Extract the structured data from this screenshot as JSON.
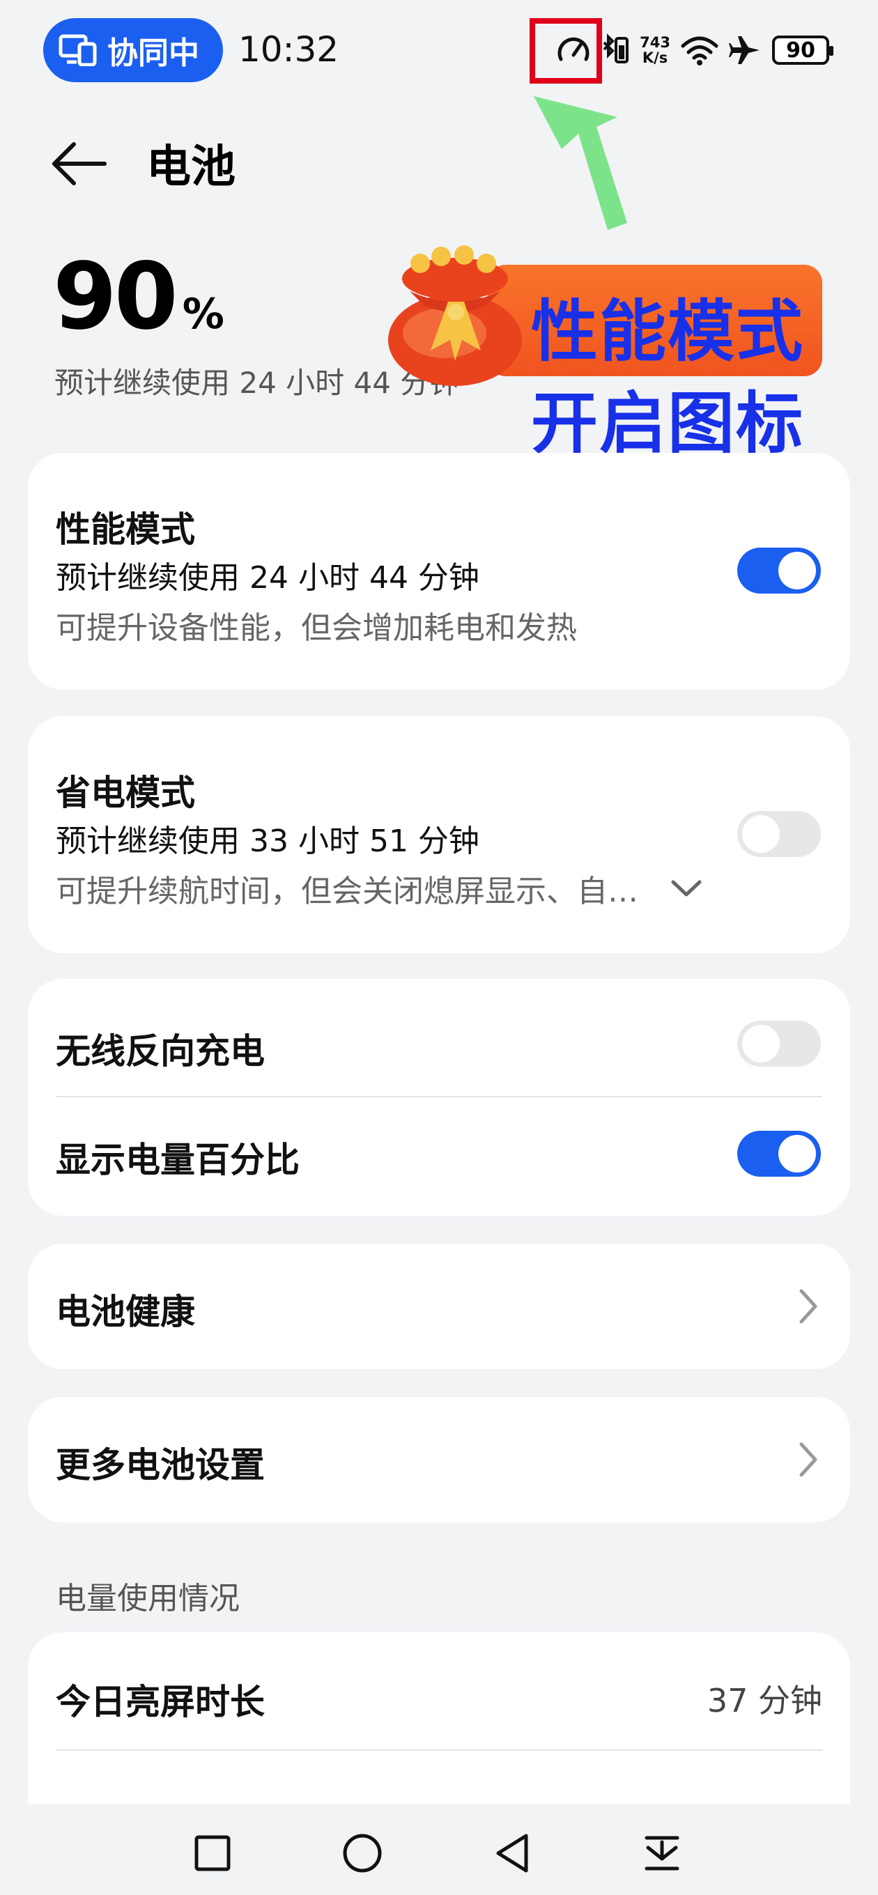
{
  "status": {
    "collab_label": "协同中",
    "time": "10:32",
    "net_speed_value": "743",
    "net_speed_unit": "K/s",
    "battery": "90"
  },
  "header": {
    "title": "电池"
  },
  "summary": {
    "percent": "90",
    "percent_sign": "%",
    "estimate": "预计继续使用 24 小时 44 分钟"
  },
  "annotation": {
    "line1": "性能模式",
    "line2": "开启图标",
    "accent_color": "#E0001A",
    "arrow_color": "#7DE38A"
  },
  "performance": {
    "title": "性能模式",
    "estimate": "预计继续使用 24 小时 44 分钟",
    "desc": "可提升设备性能，但会增加耗电和发热",
    "enabled": true
  },
  "power_saving": {
    "title": "省电模式",
    "estimate": "预计继续使用 33 小时 51 分钟",
    "desc": "可提升续航时间，但会关闭熄屏显示、自…",
    "enabled": false
  },
  "toggles": {
    "wireless_reverse": {
      "label": "无线反向充电",
      "enabled": false
    },
    "show_percent": {
      "label": "显示电量百分比",
      "enabled": true
    }
  },
  "links": {
    "battery_health": "电池健康",
    "more_settings": "更多电池设置"
  },
  "usage": {
    "section_title": "电量使用情况",
    "screen_time_label": "今日亮屏时长",
    "screen_time_value": "37 分钟"
  },
  "colors": {
    "accent": "#1B5FF0",
    "background": "#F1F3F5"
  }
}
